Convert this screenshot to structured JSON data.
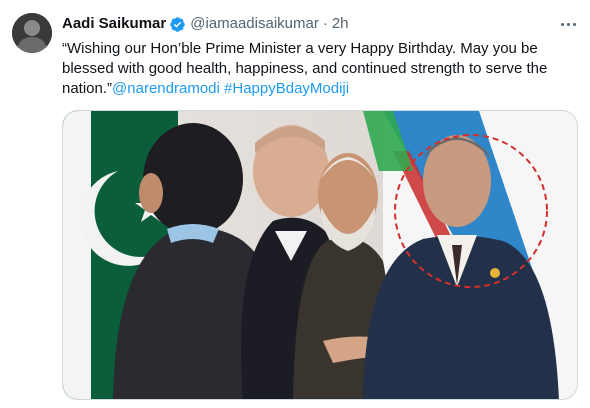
{
  "tweet": {
    "display_name": "Aadi Saikumar",
    "handle": "@iamaadisaikumar",
    "separator": "·",
    "time": "2h",
    "body_text": "“Wishing our Hon’ble Prime Minister a very Happy Birthday. May you be blessed with good health, happiness, and continued strength to serve the nation.”",
    "mention": "@narendramodi",
    "hashtag": "#HappyBdayModiji"
  },
  "icons": {
    "verified": "verified-badge-icon",
    "more": "more-options-icon"
  },
  "colors": {
    "link": "#1d9bf0",
    "verified": "#1d9bf0",
    "secondary_text": "#536471",
    "annotation_circle": "#d32f2f"
  }
}
